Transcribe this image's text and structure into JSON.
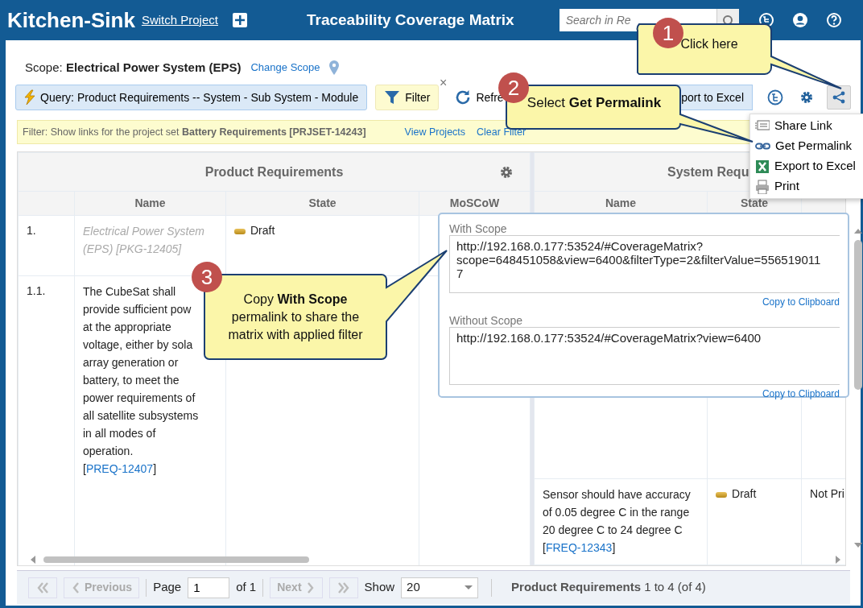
{
  "header": {
    "app_name": "Kitchen-Sink",
    "switch_link": "Switch Project",
    "title": "Traceability Coverage Matrix",
    "search": {
      "placeholder": "Search in Re"
    }
  },
  "scope": {
    "label": "Scope:",
    "value": "Electrical Power System (EPS)",
    "link": "Change Scope"
  },
  "toolbar": {
    "query": "Query: Product Requirements -- System - Sub System - Module",
    "filter": "Filter",
    "filter_close": "×",
    "refresh": "Refre",
    "export": "port to Excel",
    "share_active": true
  },
  "filter_bar": {
    "text": "Filter: Show links for the project set **Battery Requirements [PRJSET-14243]**",
    "links": [
      "View Projects",
      "Clear Filter"
    ]
  },
  "share_menu": [
    {
      "label": "Share Link",
      "kind": "share"
    },
    {
      "label": "Get Permalink",
      "kind": "link"
    },
    {
      "label": "Export to Excel",
      "kind": "excel"
    },
    {
      "label": "Print",
      "kind": "print"
    }
  ],
  "left_panel": {
    "title": "Product Requirements",
    "columns": [
      "Name",
      "State",
      "MoSCoW"
    ],
    "rows": [
      {
        "number": "1.",
        "kind": "package",
        "text_before": "Electrical Power System (EPS) [PKG-12405]",
        "state": "Draft"
      },
      {
        "number": "1.1.",
        "kind": "requirement",
        "text_before": "The CubeSat shall\nprovide sufficient pow\nat the appropriate\nvoltage, either by sola\narray generation or\nbattery, to meet the\npower requirements of\nall satellite subsystems\nin all modes of\noperation.\n[",
        "link": "PREQ-12407",
        "text_after": "]"
      }
    ]
  },
  "right_panel": {
    "title": "System Requ",
    "columns": [
      "Name",
      "State"
    ],
    "rows": [
      {
        "kind": "requirement",
        "text_before": "Sensor should have accuracy of 0.05 degree C in the range 20 degree C to 24 degree C [",
        "link": "FREQ-12343",
        "text_after": "]",
        "state": "Draft",
        "column_3": "Not Pri"
      }
    ]
  },
  "permalink_popover": [
    {
      "label": "With Scope",
      "url": "http://192.168.0.177:53524/#CoverageMatrix?\nscope=648451058&view=6400&filterType=2&filterValue=556519011\n7",
      "copy": "Copy to Clipboard"
    },
    {
      "label": "Without Scope",
      "url": "http://192.168.0.177:53524/#CoverageMatrix?view=6400",
      "copy": "Copy to Clipboard"
    }
  ],
  "pager": {
    "previous": "Previous",
    "previous_disabled": true,
    "page_label": "Page",
    "page": "1",
    "of": "of 1",
    "next": "Next",
    "next_disabled": true,
    "show_label": "Show",
    "show": "20",
    "summary_title": "Product Requirements",
    "summary": "1 to 4 (of 4)"
  },
  "callouts": [
    {
      "number": "1",
      "text": "Click here"
    },
    {
      "number": "2",
      "text": "Select **Get Permalink**"
    },
    {
      "number": "3",
      "text": "Copy **With Scope**\npermalink to share the\nmatrix with applied filter"
    }
  ]
}
